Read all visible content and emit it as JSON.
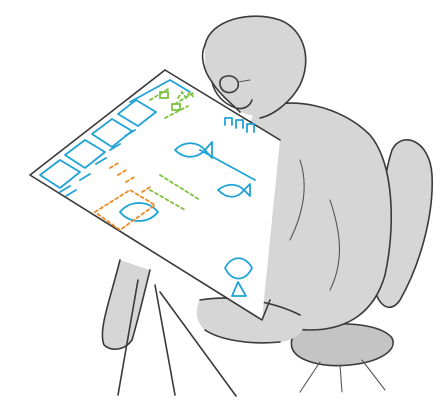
{
  "scene": {
    "subject": "person",
    "colors": {
      "ink": "#3a3a3a",
      "figure_fill": "#d6d6d6",
      "blue_ink": "#1fa3d6",
      "green_ink": "#7fc241",
      "orange_ink": "#f08a24"
    }
  }
}
